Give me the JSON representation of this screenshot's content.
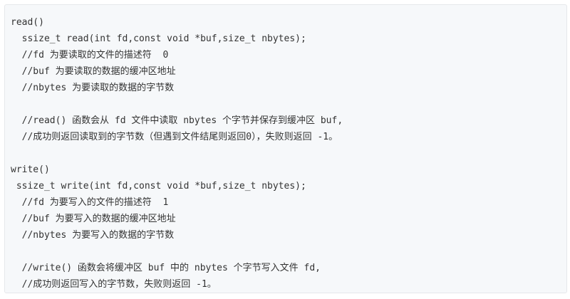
{
  "code": {
    "lines": [
      "read()",
      "  ssize_t read(int fd,const void *buf,size_t nbytes);",
      "  //fd 为要读取的文件的描述符  0",
      "  //buf 为要读取的数据的缓冲区地址",
      "  //nbytes 为要读取的数据的字节数",
      "",
      "  //read() 函数会从 fd 文件中读取 nbytes 个字节并保存到缓冲区 buf,",
      "  //成功则返回读取到的字节数（但遇到文件结尾则返回0），失败则返回 -1。",
      "",
      "write()",
      " ssize_t write(int fd,const void *buf,size_t nbytes);",
      "  //fd 为要写入的文件的描述符  1",
      "  //buf 为要写入的数据的缓冲区地址",
      "  //nbytes 为要写入的数据的字节数",
      "",
      "  //write() 函数会将缓冲区 buf 中的 nbytes 个字节写入文件 fd,",
      "  //成功则返回写入的字节数，失败则返回 -1。"
    ]
  }
}
